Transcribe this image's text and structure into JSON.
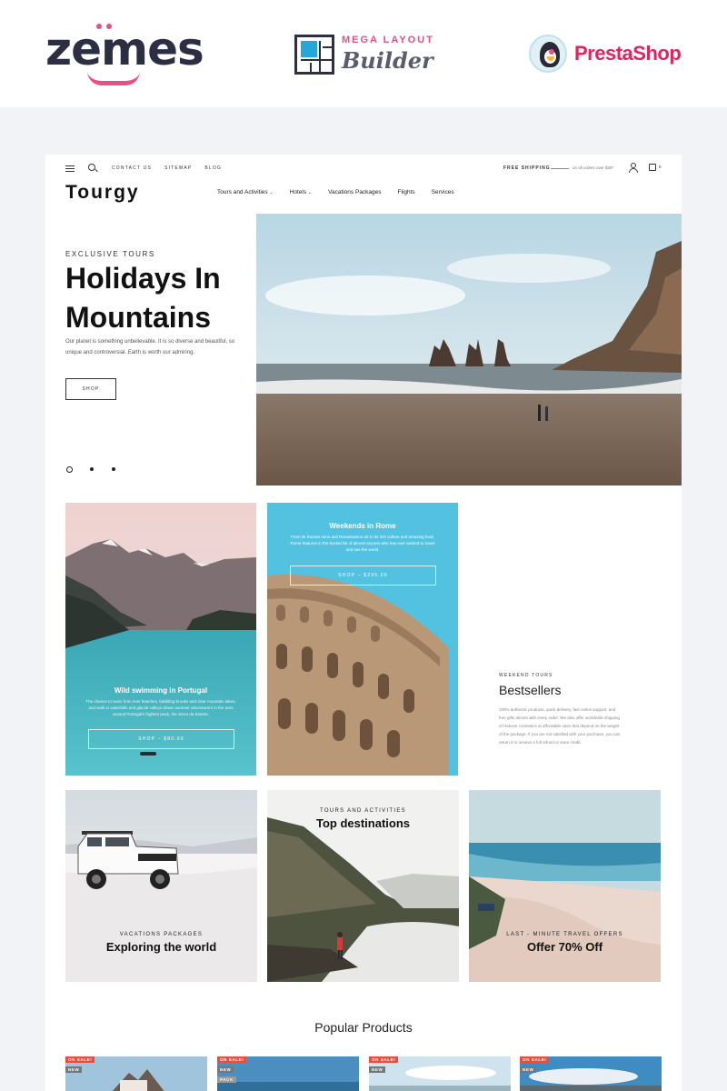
{
  "promo": {
    "zemes_logo": "zemes",
    "mega_line1": "MEGA LAYOUT",
    "mega_line2": "Builder",
    "presta_logo": "PrestaShop"
  },
  "header": {
    "top_links": [
      "CONTACT US",
      "SITEMAP",
      "BLOG"
    ],
    "free_shipping": "FREE SHIPPING",
    "free_shipping_note": "on all orders over $25*",
    "cart_count": "0",
    "brand": "Tourgy",
    "nav": [
      {
        "label": "Tours and Activities",
        "has_dropdown": true
      },
      {
        "label": "Hotels",
        "has_dropdown": true
      },
      {
        "label": "Vacations Packages",
        "has_dropdown": false
      },
      {
        "label": "Flights",
        "has_dropdown": false
      },
      {
        "label": "Services",
        "has_dropdown": false
      }
    ],
    "icons": [
      "menu-icon",
      "search-icon",
      "user-icon",
      "bag-icon",
      "chevron-down-icon"
    ]
  },
  "hero": {
    "kicker": "EXCLUSIVE TOURS",
    "title": "Holidays In Mountains",
    "text": "Our planet is something unbelievable. It is so diverse and beautiful, so unique and controversial. Earth is worth our admiring.",
    "button": "SHOP",
    "slides": 3,
    "active_slide": 1
  },
  "tiles": {
    "portugal": {
      "title": "Wild swimming in Portugal",
      "text": "The chance to swim from river beaches, babbling brooks and clear mountain lakes, and walk to waterfalls and glacial valleys draws summer adventurers to the area around Portugal's highest peak, the Serra da Estrela.",
      "button": "SHOP – $80.00"
    },
    "rome": {
      "title": "Weekends in Rome",
      "text": "From its Roman ruins and Renaissance art to its rich culture and amazing food, Rome features in the bucket list of almost anyone who has ever wished to travel and see the world.",
      "button": "SHOP – $295.00"
    },
    "bestsellers": {
      "kicker": "WEEKEND TOURS",
      "title": "Bestsellers",
      "text": "100% authentic products, quick delivery, fast online support, and free gifts almost with every order. We also offer worldwide shipping of Hakone cosmetics at affordable rates that depend on the weight of the package. If you are not satisfied with your purchase, you can return it to receive a full refund or store credit."
    },
    "world": {
      "kicker": "VACATIONS PACKAGES",
      "title": "Exploring the world"
    },
    "destinations": {
      "kicker": "TOURS AND ACTIVITIES",
      "title": "Top destinations"
    },
    "offer": {
      "kicker": "LAST - MINUTE TRAVEL OFFERS",
      "title": "Offer 70% Off"
    }
  },
  "popular": {
    "title": "Popular Products",
    "products": [
      {
        "badges": [
          "ON SALE!",
          "NEW"
        ]
      },
      {
        "badges": [
          "ON SALE!",
          "NEW",
          "PACK"
        ]
      },
      {
        "badges": [
          "ON SALE!",
          "NEW"
        ]
      },
      {
        "badges": [
          "ON SALE!",
          "NEW"
        ]
      }
    ]
  },
  "colors": {
    "accent_pink": "#e94e86",
    "brand_dark": "#2c2f44",
    "sale_red": "#e94e3c",
    "teal_tile": "#2fb0c4",
    "sky_blue": "#52c2e0"
  }
}
